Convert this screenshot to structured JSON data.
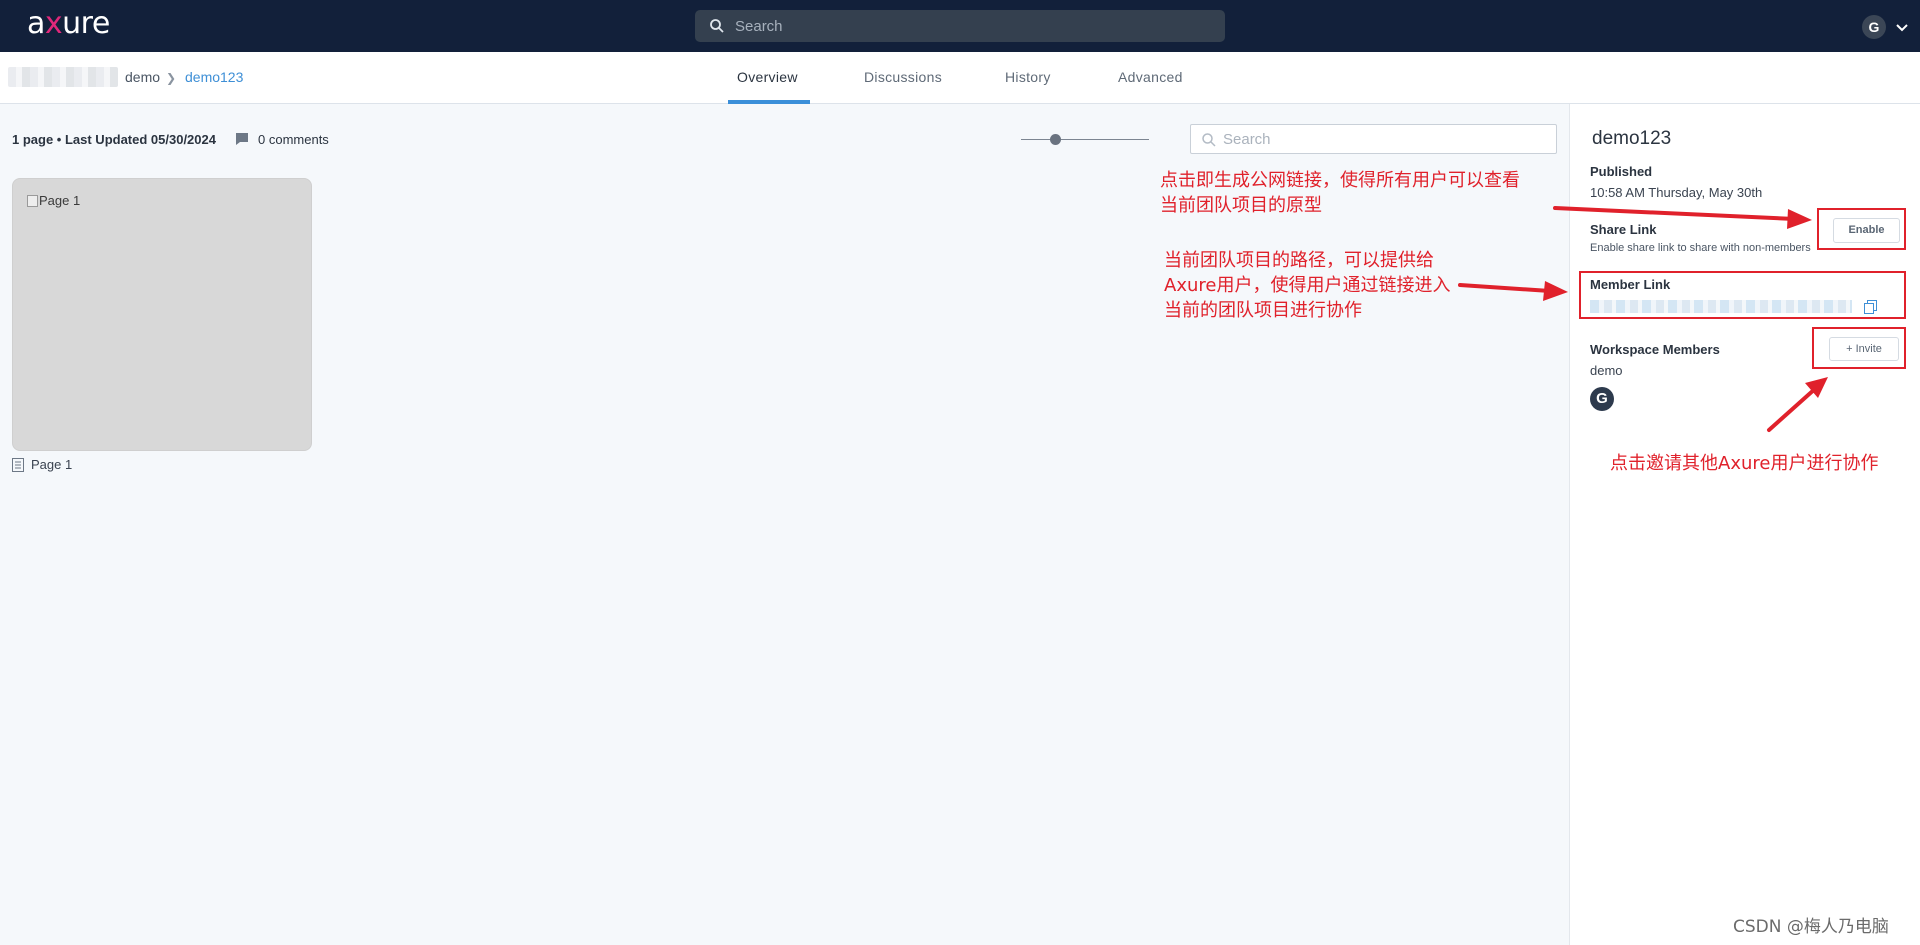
{
  "topbar": {
    "logo_prefix": "a",
    "logo_x": "x",
    "logo_suffix": "ure",
    "search_placeholder": "Search",
    "user_initial": "G"
  },
  "breadcrumb": {
    "root": "demo",
    "current": "demo123"
  },
  "tabs": [
    {
      "label": "Overview",
      "active": true
    },
    {
      "label": "Discussions",
      "active": false
    },
    {
      "label": "History",
      "active": false
    },
    {
      "label": "Advanced",
      "active": false
    }
  ],
  "overview": {
    "summary": "1 page • Last Updated 05/30/2024",
    "comments": "0 comments",
    "search_placeholder": "Search",
    "zoom_fraction": 0.27,
    "pages": [
      {
        "thumb_alt": "Page 1",
        "label": "Page 1"
      }
    ]
  },
  "panel": {
    "project_name": "demo123",
    "published_label": "Published",
    "published_time": "10:58 AM Thursday, May 30th",
    "share_link_label": "Share Link",
    "share_link_desc": "Enable share link to share with non-members",
    "enable_button": "Enable",
    "member_link_label": "Member Link",
    "workspace_members_label": "Workspace Members",
    "invite_button": "+ Invite",
    "workspace_name": "demo",
    "member_initial": "G"
  },
  "annotations": {
    "share_note_line1": "点击即生成公网链接，使得所有用户可以查看",
    "share_note_line2": "当前团队项目的原型",
    "member_note_line1": "当前团队项目的路径，可以提供给",
    "member_note_line2": "Axure用户，使得用户通过链接进入",
    "member_note_line3": "当前的团队项目进行协作",
    "invite_note": "点击邀请其他Axure用户进行协作",
    "color": "#e0212b"
  },
  "watermark": "CSDN @梅人乃电脑",
  "colors": {
    "topbar": "#12203a",
    "accent": "#3b8fd9",
    "link": "#3e8fd6"
  }
}
